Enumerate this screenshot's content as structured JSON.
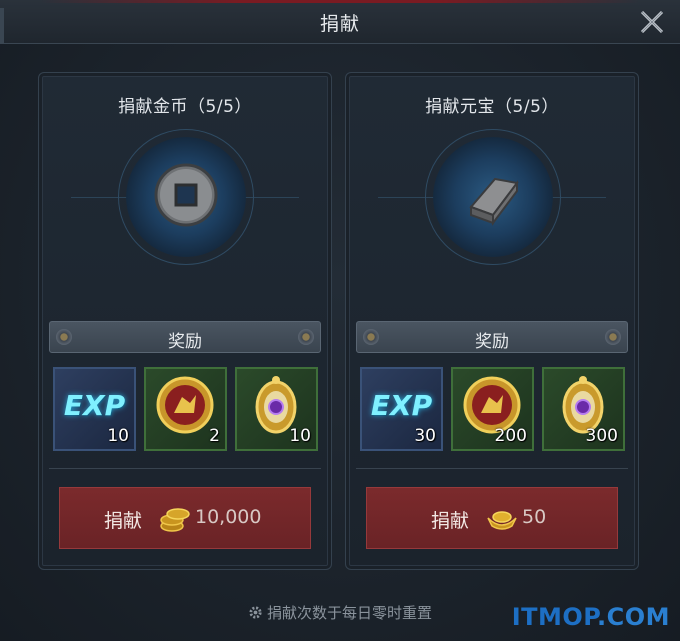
{
  "window": {
    "title": "捐献"
  },
  "cards": [
    {
      "title": "捐献金币（5/5）",
      "emblem_icon": "copper-coin-icon",
      "reward_label": "奖励",
      "rewards": [
        {
          "icon": "exp-icon",
          "text": "EXP",
          "qty": "10"
        },
        {
          "icon": "guild-medal-icon",
          "qty": "2"
        },
        {
          "icon": "purple-gem-amulet-icon",
          "qty": "10"
        }
      ],
      "button": {
        "label": "捐献",
        "currency_icon": "gold-coins-icon",
        "cost": "10,000"
      }
    },
    {
      "title": "捐献元宝（5/5）",
      "emblem_icon": "silver-ingot-icon",
      "reward_label": "奖励",
      "rewards": [
        {
          "icon": "exp-icon",
          "text": "EXP",
          "qty": "30"
        },
        {
          "icon": "guild-medal-icon",
          "qty": "200"
        },
        {
          "icon": "purple-gem-amulet-icon",
          "qty": "300"
        }
      ],
      "button": {
        "label": "捐献",
        "currency_icon": "gold-ingot-icon",
        "cost": "50"
      }
    }
  ],
  "footer": {
    "note": "捐献次数于每日零时重置"
  },
  "watermark": {
    "part1": "ITMOP",
    "part2": ".COM"
  }
}
